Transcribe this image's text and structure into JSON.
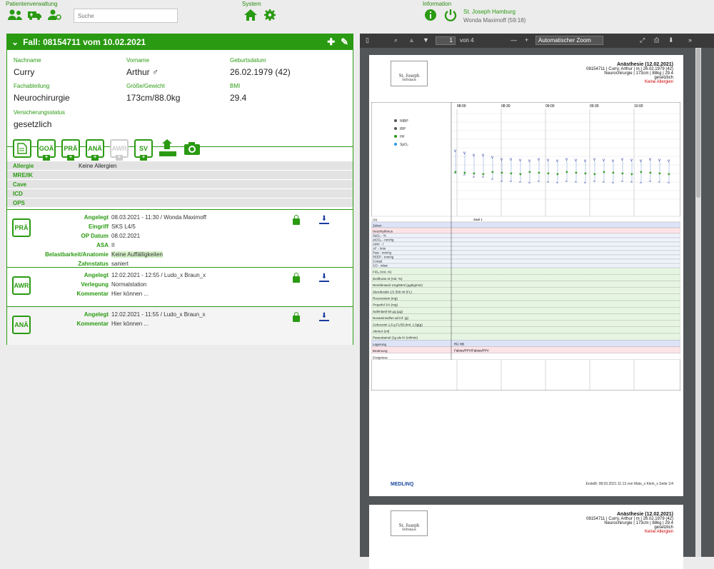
{
  "topbar": {
    "patient_admin": "Patientenverwaltung",
    "system": "System",
    "information": "Information",
    "search_placeholder": "Suche",
    "hospital": "St. Joseph Hamburg",
    "user": "Wonda Maximoff (59:18)"
  },
  "case": {
    "title": "Fall:  08154711 vom 10.02.2021",
    "last_name_label": "Nachname",
    "last_name": "Curry",
    "first_name_label": "Vorname",
    "first_name": "Arthur ♂",
    "dob_label": "Geburtsdatum",
    "dob": "26.02.1979 (42)",
    "dept_label": "Fachabteilung",
    "dept": "Neurochirurgie",
    "size_label": "Größe/Gewicht",
    "size": "173cm/88.0kg",
    "bmi_label": "BMI",
    "bmi": "29.4",
    "ins_label": "Versicherungsstatus",
    "ins": "gesetzlich"
  },
  "doc_buttons": [
    "GOÄ",
    "PRÄ",
    "ANÄ",
    "AWR",
    "SV"
  ],
  "info_rows": [
    {
      "k": "Allergie",
      "v": "Keine Allergien"
    },
    {
      "k": "MRE/IK",
      "v": ""
    },
    {
      "k": "Cave",
      "v": ""
    },
    {
      "k": "ICD",
      "v": ""
    },
    {
      "k": "OPS",
      "v": ""
    }
  ],
  "pra": {
    "badge": "PRÄ",
    "rows": [
      {
        "k": "Angelegt",
        "v": "08.03.2021 - 11:30 / Wonda Maximoff"
      },
      {
        "k": "Eingriff",
        "v": "SKS L4/5"
      },
      {
        "k": "OP Datum",
        "v": "08.02.2021"
      },
      {
        "k": "ASA",
        "v": "II"
      },
      {
        "k": "Belastbarkeit/Anatomie",
        "v": "Keine Auffälligkeiten"
      },
      {
        "k": "Zahnstatus",
        "v": "saniert"
      }
    ]
  },
  "awr": {
    "badge": "AWR",
    "rows": [
      {
        "k": "Angelegt",
        "v": "12.02.2021 - 12:55 / Ludo_x Braun_x"
      },
      {
        "k": "Verlegung",
        "v": "Normalstation"
      },
      {
        "k": "Kommentar",
        "v": "Hier können ..."
      }
    ]
  },
  "ana": {
    "badge": "ANÄ",
    "rows": [
      {
        "k": "Angelegt",
        "v": "12.02.2021 - 11:55 / Ludo_x Braun_x"
      },
      {
        "k": "Kommentar",
        "v": "Hier können ..."
      }
    ]
  },
  "pdf": {
    "page": "1",
    "of": "von 4",
    "zoom": "Automatischer Zoom",
    "doc_title": "Anästhesie (12.02.2021)",
    "line1": "08154711 | Curry, Arthur | m | 26.02.1979 (42)",
    "line2": "Neurochirurgie | 173cm | 88kg | 29.4",
    "line3": "gesetzlich",
    "allergy": "Keine Allergien",
    "logo": "St. Joseph",
    "logo_sub": "Stiftshaus",
    "footer_brand": "MEDLINQ",
    "footer": "Erstellt: 08.03.2021 11:13 von Mats_x Klein_x Seite 1/4",
    "times": [
      "08:00",
      "08:30",
      "09:00",
      "09:30",
      "10:00"
    ],
    "legend": [
      "NIBP",
      "IBP",
      "HF",
      "SpO₂"
    ],
    "rows": [
      "Ort",
      "Zeiten",
      "Herzrhythmus",
      "SaO₂ - %",
      "etCO₂ - mmHg",
      "AMV - l",
      "AF - /min",
      "Paw - mmHg",
      "PEEP - mmHg",
      "Compl.",
      "CO - mbar",
      "FiO₂ (Vol.-%)",
      "Desfluran et (Vol.-%)",
      "Remifentanil 1mg/50ml (µg/kg/min)",
      "Sterofundin 1/1 500 ml (FL)",
      "Rocuronium (mg)",
      "Propofol 1% (mg)",
      "Sufentanil 50 µg (µg)",
      "Novaminsulfon ad inf. (g)",
      "Cefuroxim 1,5 g FL/50,0ml, 1,5g(g)",
      "Akrinor (ml)",
      "Paracetamol (1g als KI (ml/min)",
      "Lagerung",
      "Beatmung",
      "Ereignisse"
    ],
    "ort": "Saal 1",
    "lagerung": "RÜ          HB",
    "beatmung": "Fabius/PPV/Fabius/PPV"
  }
}
